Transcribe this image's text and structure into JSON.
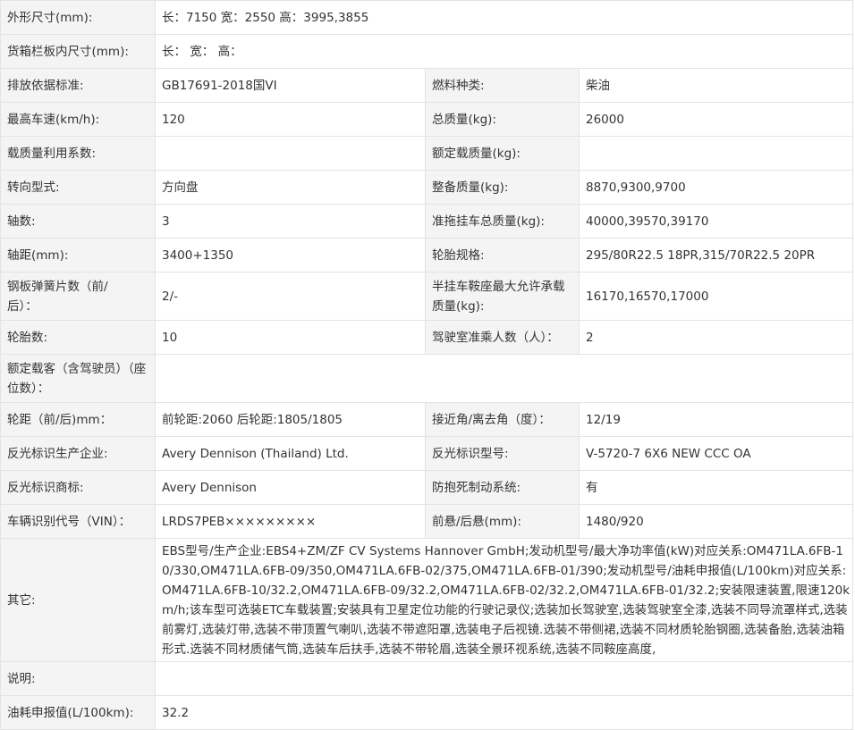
{
  "rows": [
    {
      "label": "外形尺寸(mm):",
      "value": "长：7150 宽：2550 高：3995,3855"
    },
    {
      "label": "货箱栏板内尺寸(mm):",
      "value": "长： 宽： 高："
    },
    {
      "label": "排放依据标准:",
      "value": "GB17691-2018国VI",
      "label2": "燃料种类:",
      "value2": "柴油"
    },
    {
      "label": "最高车速(km/h):",
      "value": "120",
      "label2": "总质量(kg):",
      "value2": "26000"
    },
    {
      "label": "载质量利用系数:",
      "value": "",
      "label2": "额定载质量(kg):",
      "value2": ""
    },
    {
      "label": "转向型式:",
      "value": "方向盘",
      "label2": "整备质量(kg):",
      "value2": "8870,9300,9700"
    },
    {
      "label": "轴数:",
      "value": "3",
      "label2": "准拖挂车总质量(kg):",
      "value2": "40000,39570,39170"
    },
    {
      "label": "轴距(mm):",
      "value": "3400+1350",
      "label2": "轮胎规格:",
      "value2": "295/80R22.5 18PR,315/70R22.5 20PR"
    },
    {
      "label": "钢板弹簧片数（前/后）：",
      "value": "2/-",
      "label2": "半挂车鞍座最大允许承载质量(kg):",
      "value2": "16170,16570,17000"
    },
    {
      "label": "轮胎数:",
      "value": "10",
      "label2": "驾驶室准乘人数（人）：",
      "value2": "2"
    },
    {
      "label": "额定载客（含驾驶员）（座位数）：",
      "value": ""
    },
    {
      "label": "轮距（前/后)mm：",
      "value": "前轮距:2060 后轮距:1805/1805",
      "label2": "接近角/离去角（度）：",
      "value2": "12/19"
    },
    {
      "label": "反光标识生产企业:",
      "value": "Avery Dennison (Thailand) Ltd.",
      "label2": "反光标识型号:",
      "value2": "V-5720-7 6X6 NEW CCC OA"
    },
    {
      "label": "反光标识商标:",
      "value": "Avery Dennison",
      "label2": "防抱死制动系统:",
      "value2": "有"
    },
    {
      "label": "车辆识别代号（VIN）：",
      "value": "LRDS7PEB×××××××××",
      "label2": "前悬/后悬(mm):",
      "value2": "1480/920"
    },
    {
      "label": "其它:",
      "value": "EBS型号/生产企业:EBS4+ZM/ZF CV Systems Hannover GmbH;发动机型号/最大净功率值(kW)对应关系:OM471LA.6FB-10/330,OM471LA.6FB-09/350,OM471LA.6FB-02/375,OM471LA.6FB-01/390;发动机型号/油耗申报值(L/100km)对应关系:OM471LA.6FB-10/32.2,OM471LA.6FB-09/32.2,OM471LA.6FB-02/32.2,OM471LA.6FB-01/32.2;安装限速装置,限速120km/h;该车型可选装ETC车载装置;安装具有卫星定位功能的行驶记录仪;选装加长驾驶室,选装驾驶室全漆,选装不同导流罩样式,选装前雾灯,选装灯带,选装不带顶置气喇叭,选装不带遮阳罩,选装电子后视镜.选装不带侧裙,选装不同材质轮胎钢圈,选装备胎,选装油箱形式.选装不同材质储气筒,选装车后扶手,选装不带轮眉,选装全景环视系统,选装不同鞍座高度,"
    },
    {
      "label": "说明:",
      "value": ""
    },
    {
      "label": "油耗申报值(L/100km):",
      "value": "32.2"
    }
  ]
}
